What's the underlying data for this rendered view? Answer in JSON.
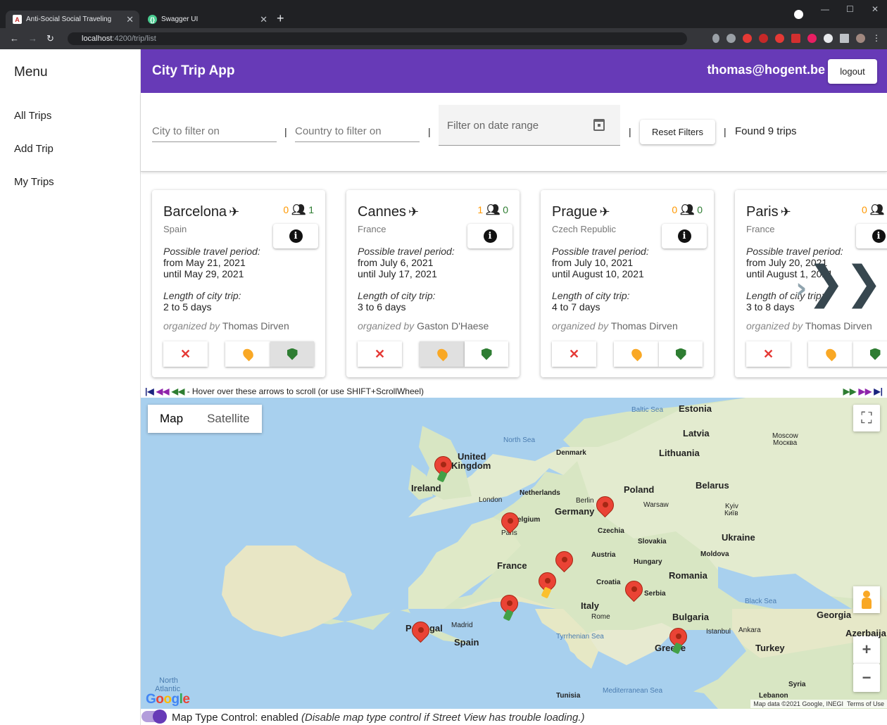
{
  "browser": {
    "tabs": [
      {
        "title": "Anti-Social Social Traveling",
        "active": true
      },
      {
        "title": "Swagger UI",
        "active": false
      }
    ],
    "url_host": "localhost",
    "url_path": ":4200/trip/list"
  },
  "sidebar": {
    "title": "Menu",
    "items": [
      {
        "label": "All Trips"
      },
      {
        "label": "Add Trip"
      },
      {
        "label": "My Trips"
      }
    ]
  },
  "header": {
    "title": "City Trip App",
    "user": "thomas@hogent.be",
    "logout_label": "logout"
  },
  "filters": {
    "city_placeholder": "City to filter on",
    "country_placeholder": "Country to filter on",
    "date_placeholder": "Filter on date range",
    "separator": "|",
    "reset_label": "Reset Filters",
    "found_text": "Found 9 trips"
  },
  "trips": [
    {
      "city": "Barcelona",
      "country": "Spain",
      "count_a": "0",
      "count_b": "1",
      "period_label": "Possible travel period:",
      "from": "from May 21, 2021",
      "until": "until May 29, 2021",
      "length_label": "Length of city trip:",
      "length": "2 to 5 days",
      "organized_prefix": "organized by",
      "organizer": "Thomas Dirven"
    },
    {
      "city": "Cannes",
      "country": "France",
      "count_a": "1",
      "count_b": "0",
      "period_label": "Possible travel period:",
      "from": "from July 6, 2021",
      "until": "until July 17, 2021",
      "length_label": "Length of city trip:",
      "length": "3 to 6 days",
      "organized_prefix": "organized by",
      "organizer": "Gaston D'Haese"
    },
    {
      "city": "Prague",
      "country": "Czech Republic",
      "count_a": "0",
      "count_b": "0",
      "period_label": "Possible travel period:",
      "from": "from July 10, 2021",
      "until": "until August 10, 2021",
      "length_label": "Length of city trip:",
      "length": "4 to 7 days",
      "organized_prefix": "organized by",
      "organizer": "Thomas Dirven"
    },
    {
      "city": "Paris",
      "country": "France",
      "count_a": "0",
      "count_b": "",
      "period_label": "Possible travel period:",
      "from": "from July 20, 2021",
      "until": "until August 1, 2021",
      "length_label": "Length of city trip:",
      "length": "3 to 8 days",
      "organized_prefix": "organized by",
      "organizer": "Thomas Dirven"
    }
  ],
  "scroll_note": "- Hover over these arrows to scroll (or use SHIFT+ScrollWheel)",
  "map": {
    "type_map": "Map",
    "type_satellite": "Satellite",
    "attribution": "Map data ©2021 Google, INEGI",
    "terms": "Terms of Use",
    "labels": {
      "north_sea": "North Sea",
      "baltic_sea": "Baltic Sea",
      "estonia": "Estonia",
      "latvia": "Latvia",
      "moscow": "Moscow",
      "moscow_ru": "Москва",
      "denmark": "Denmark",
      "lithuania": "Lithuania",
      "united": "United",
      "kingdom": "Kingdom",
      "ireland": "Ireland",
      "belarus": "Belarus",
      "netherlands": "Netherlands",
      "london": "London",
      "berlin": "Berlin",
      "poland": "Poland",
      "warsaw": "Warsaw",
      "germany": "Germany",
      "kyiv": "Kyiv",
      "kyiv_uk": "Київ",
      "belgium": "elgium",
      "paris": "Paris",
      "czechia": "Czechia",
      "slovakia": "Slovakia",
      "ukraine": "Ukraine",
      "austria": "Austria",
      "hungary": "Hungary",
      "moldova": "Moldova",
      "france": "France",
      "romania": "Romania",
      "croatia": "Croatia",
      "serbia": "Serbia",
      "black_sea": "Black Sea",
      "italy": "Italy",
      "rome": "Rome",
      "bulgaria": "Bulgaria",
      "georgia": "Georgia",
      "portugal": "Portugal",
      "madrid": "Madrid",
      "spain": "Spain",
      "tyrrhenian": "Tyrrhenian Sea",
      "greece": "Greece",
      "istanbul": "Istanbul",
      "ankara": "Ankara",
      "azerbaijan": "Azerbaija",
      "turkey": "Turkey",
      "north_atlantic_1": "North",
      "north_atlantic_2": "Atlantic",
      "tunisia": "Tunisia",
      "mediterranean": "Mediterranean Sea",
      "syria": "Syria",
      "lebanon": "Lebanon"
    }
  },
  "toggle": {
    "label": "Map Type Control: enabled",
    "hint": "(Disable map type control if Street View has trouble loading.)"
  },
  "colors": {
    "primary": "#673ab7",
    "count_orange": "#ff9800",
    "count_green": "#2e7d32",
    "decline_red": "#e53935",
    "marker_red": "#ea4335"
  }
}
